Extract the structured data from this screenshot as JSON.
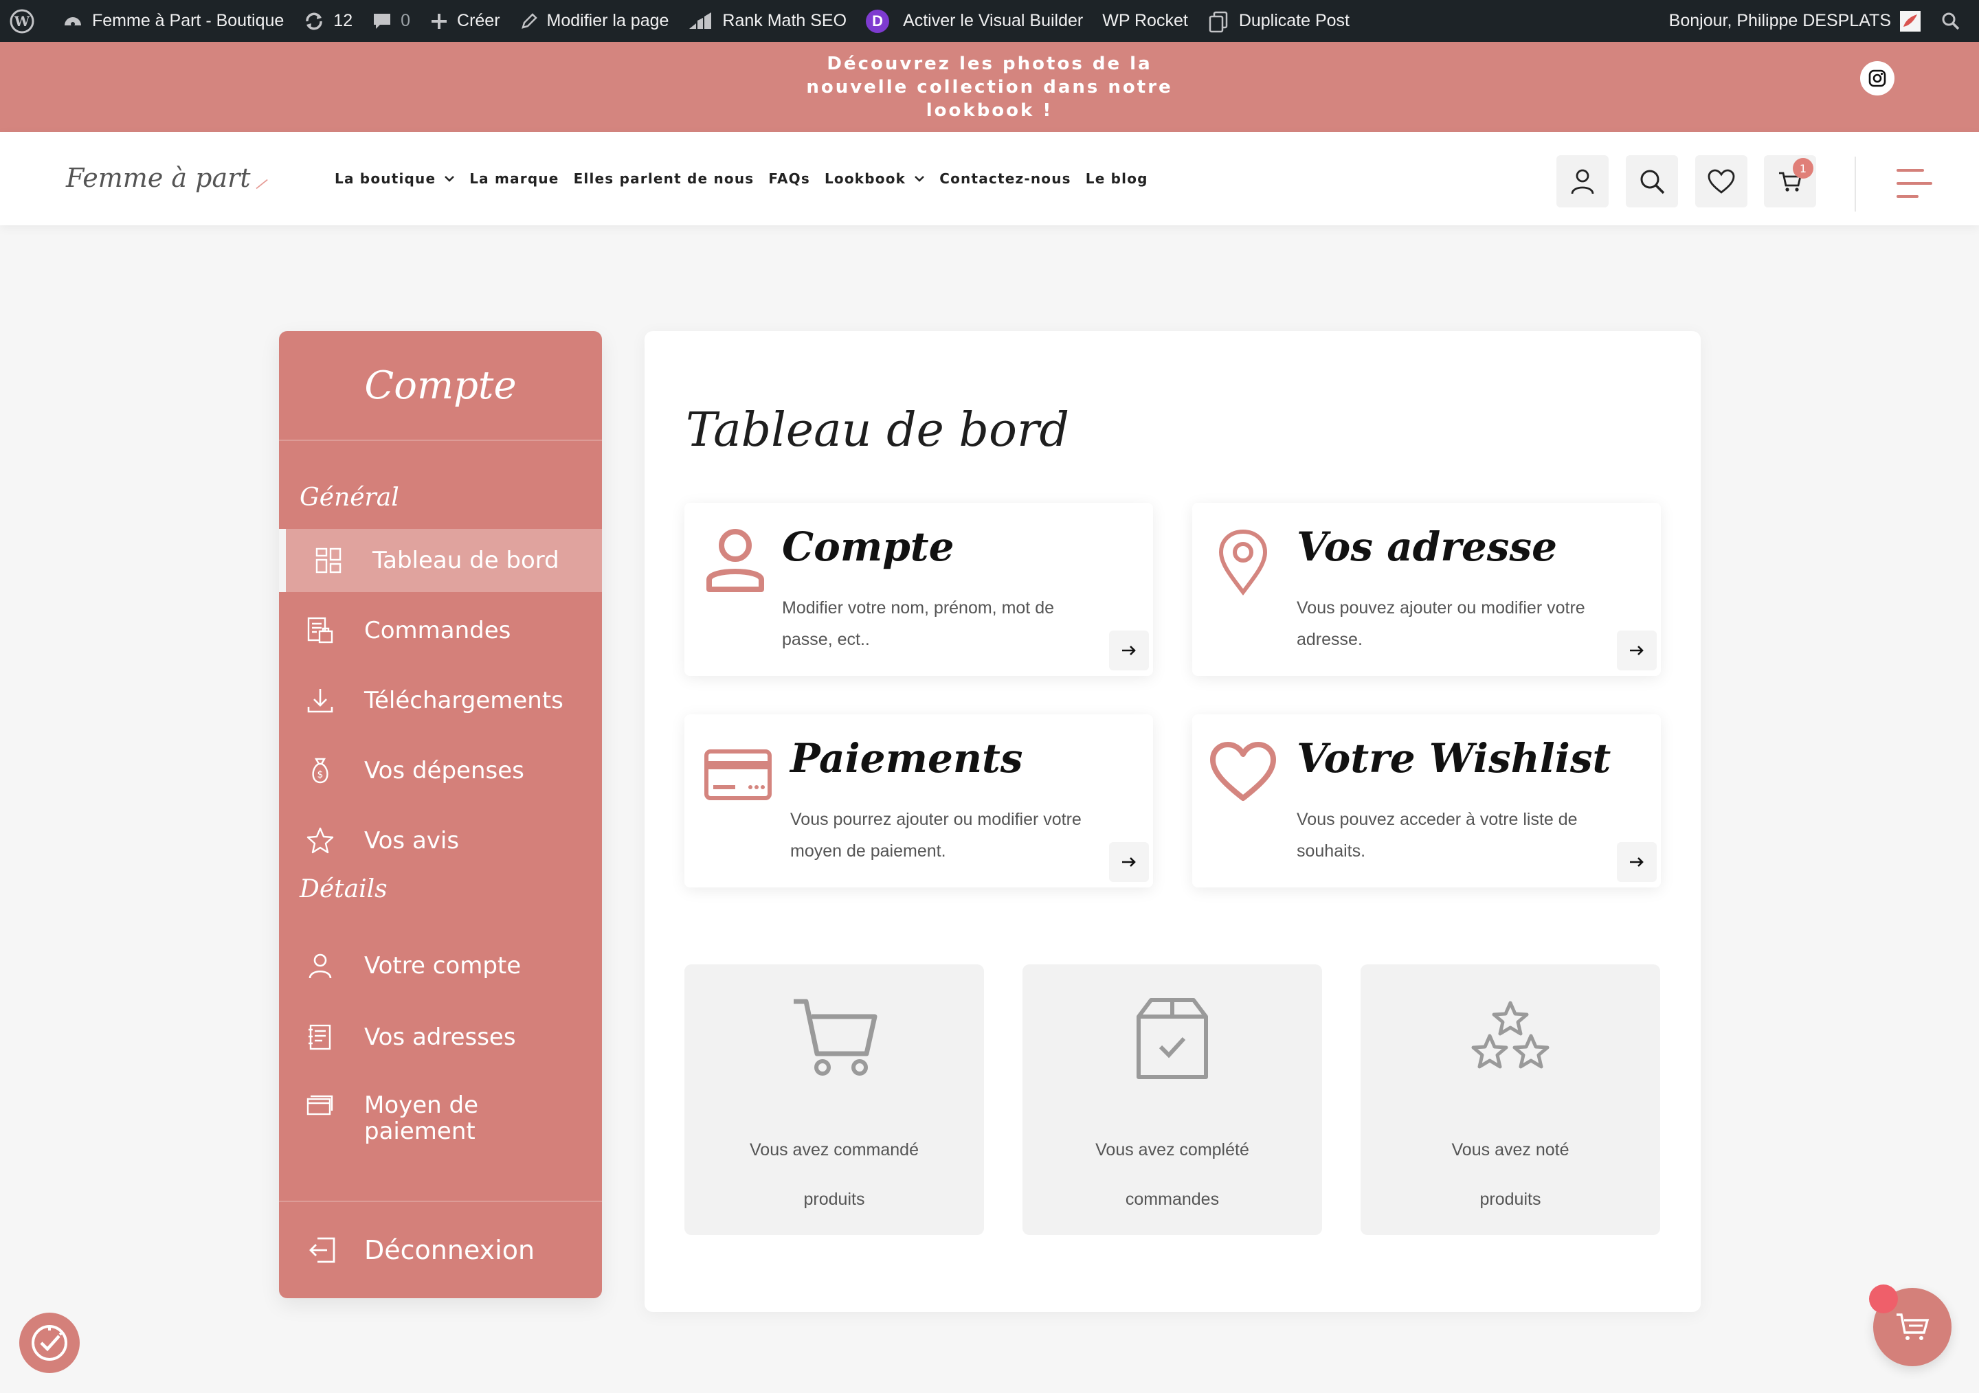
{
  "adminbar": {
    "site_name": "Femme à Part - Boutique",
    "updates_count": "12",
    "comments_count": "0",
    "create_label": "Créer",
    "edit_page_label": "Modifier la page",
    "rank_math_label": "Rank Math SEO",
    "visual_builder_label": "Activer le Visual Builder",
    "divi_letter": "D",
    "wp_rocket_label": "WP Rocket",
    "duplicate_post_label": "Duplicate Post",
    "greeting": "Bonjour, Philippe DESPLATS"
  },
  "promo": {
    "text": "Découvrez les photos de la nouvelle collection dans notre lookbook !"
  },
  "header": {
    "logo_text": "Femme à part",
    "nav": [
      "La boutique",
      "La marque",
      "Elles parlent de nous",
      "FAQs",
      "Lookbook",
      "Contactez-nous",
      "Le blog"
    ],
    "cart_count": "1"
  },
  "sidebar": {
    "title": "Compte",
    "section_general": "Général",
    "items_general": [
      {
        "label": "Tableau de bord",
        "icon": "dashboard-grid-icon",
        "active": true
      },
      {
        "label": "Commandes",
        "icon": "orders-icon"
      },
      {
        "label": "Téléchargements",
        "icon": "download-icon"
      },
      {
        "label": "Vos dépenses",
        "icon": "money-bag-icon"
      },
      {
        "label": "Vos avis",
        "icon": "star-icon"
      }
    ],
    "section_details": "Détails",
    "items_details": [
      {
        "label": "Votre compte",
        "icon": "user-icon"
      },
      {
        "label": "Vos adresses",
        "icon": "address-book-icon"
      },
      {
        "label": "Moyen de paiement",
        "icon": "wallet-icon"
      }
    ],
    "logout_label": "Déconnexion"
  },
  "main": {
    "title": "Tableau de bord",
    "cards": [
      {
        "title": "Compte",
        "desc": "Modifier votre nom, prénom, mot de passe, ect..",
        "icon": "user-icon"
      },
      {
        "title": "Vos adresse",
        "desc": "Vous pouvez ajouter ou modifier votre adresse.",
        "icon": "location-pin-icon"
      },
      {
        "title": "Paiements",
        "desc": "Vous pourrez ajouter ou modifier votre moyen de paiement.",
        "icon": "credit-card-icon"
      },
      {
        "title": "Votre Wishlist",
        "desc": "Vous pouvez acceder à votre liste de souhaits.",
        "icon": "heart-icon"
      }
    ],
    "stats": [
      {
        "line1": "Vous avez commandé",
        "line2": "produits",
        "icon": "cart-icon"
      },
      {
        "line1": "Vous avez complété",
        "line2": "commandes",
        "icon": "package-check-icon"
      },
      {
        "line1": "Vous avez noté",
        "line2": "produits",
        "icon": "stars-icon"
      }
    ]
  },
  "colors": {
    "accent": "#d4807a",
    "accent_light": "#e0a39e",
    "adminbar": "#1d2327",
    "icon_pink": "#d4857f"
  }
}
